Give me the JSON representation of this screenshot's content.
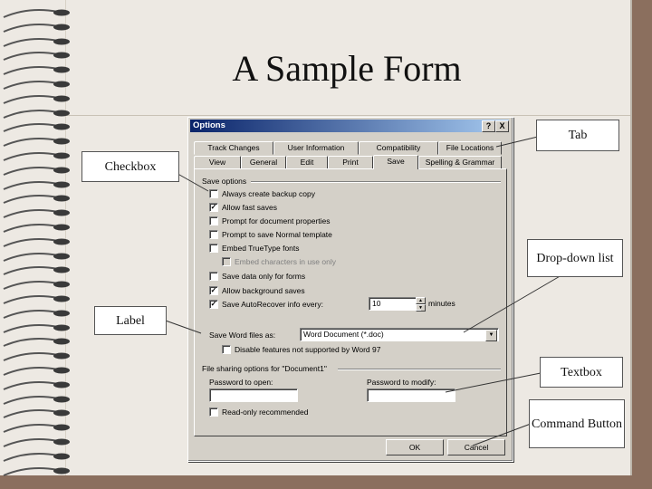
{
  "slide": {
    "title": "A Sample Form"
  },
  "dialog": {
    "title": "Options",
    "help_btn": "?",
    "close_btn": "X",
    "tabs_row1": [
      "Track Changes",
      "User Information",
      "Compatibility",
      "File Locations"
    ],
    "tabs_row2": [
      "View",
      "General",
      "Edit",
      "Print",
      "Save",
      "Spelling & Grammar"
    ],
    "active_tab": "Save",
    "save_options_label": "Save options",
    "options": [
      {
        "label": "Always create backup copy",
        "checked": false,
        "disabled": false
      },
      {
        "label": "Allow fast saves",
        "checked": true,
        "disabled": false
      },
      {
        "label": "Prompt for document properties",
        "checked": false,
        "disabled": false
      },
      {
        "label": "Prompt to save Normal template",
        "checked": false,
        "disabled": false
      },
      {
        "label": "Embed TrueType fonts",
        "checked": false,
        "disabled": false
      },
      {
        "label": "Embed characters in use only",
        "checked": false,
        "disabled": true
      },
      {
        "label": "Save data only for forms",
        "checked": false,
        "disabled": false
      },
      {
        "label": "Allow background saves",
        "checked": true,
        "disabled": false
      },
      {
        "label": "Save AutoRecover info every:",
        "checked": true,
        "disabled": false
      }
    ],
    "autorecover_value": "10",
    "autorecover_unit": "minutes",
    "save_as_label": "Save Word files as:",
    "save_as_value": "Word Document (*.doc)",
    "disable_features_label": "Disable features not supported by Word 97",
    "file_sharing_label": "File sharing options for \"Document1\"",
    "password_open_label": "Password to open:",
    "password_modify_label": "Password to modify:",
    "readonly_label": "Read-only recommended",
    "ok_label": "OK",
    "cancel_label": "Cancel"
  },
  "callouts": {
    "tab": "Tab",
    "checkbox": "Checkbox",
    "dropdown": "Drop-down list",
    "label": "Label",
    "textbox": "Textbox",
    "command": "Command Button"
  }
}
